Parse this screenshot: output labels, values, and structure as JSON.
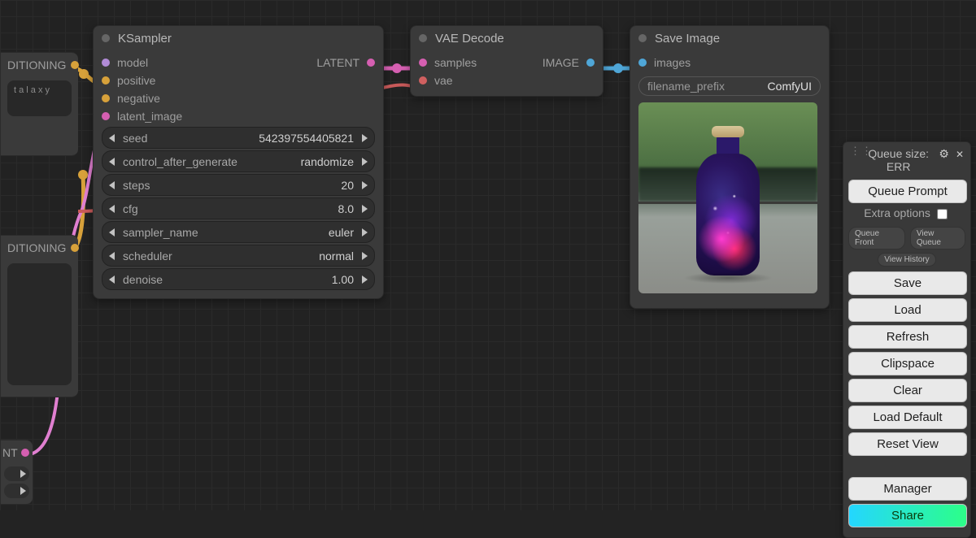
{
  "frag_top": {
    "title": "DITIONING",
    "text": "t a l a x y"
  },
  "frag_mid": {
    "title": "DITIONING"
  },
  "frag_bot": {
    "title": "NT"
  },
  "ksampler": {
    "title": "KSampler",
    "inputs": {
      "model": "model",
      "positive": "positive",
      "negative": "negative",
      "latent_image": "latent_image"
    },
    "output_label": "LATENT",
    "params": {
      "seed": {
        "label": "seed",
        "value": "542397554405821"
      },
      "control_after_generate": {
        "label": "control_after_generate",
        "value": "randomize"
      },
      "steps": {
        "label": "steps",
        "value": "20"
      },
      "cfg": {
        "label": "cfg",
        "value": "8.0"
      },
      "sampler_name": {
        "label": "sampler_name",
        "value": "euler"
      },
      "scheduler": {
        "label": "scheduler",
        "value": "normal"
      },
      "denoise": {
        "label": "denoise",
        "value": "1.00"
      }
    }
  },
  "vae": {
    "title": "VAE Decode",
    "inputs": {
      "samples": "samples",
      "vae": "vae"
    },
    "output_label": "IMAGE"
  },
  "save": {
    "title": "Save Image",
    "input": "images",
    "prefix_label": "filename_prefix",
    "prefix_value": "ComfyUI"
  },
  "panel": {
    "queue_size_label": "Queue size:",
    "queue_size_value": "ERR",
    "queue_prompt": "Queue Prompt",
    "extra_options": "Extra options",
    "queue_front": "Queue Front",
    "view_queue": "View Queue",
    "view_history": "View History",
    "save": "Save",
    "load": "Load",
    "refresh": "Refresh",
    "clipspace": "Clipspace",
    "clear": "Clear",
    "load_default": "Load Default",
    "reset_view": "Reset View",
    "manager": "Manager",
    "share": "Share"
  }
}
